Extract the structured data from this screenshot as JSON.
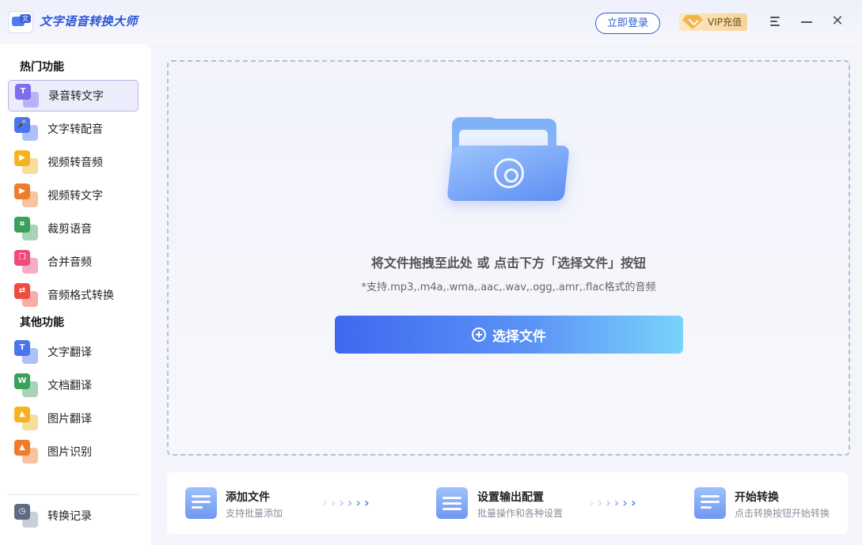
{
  "app": {
    "title": "文字语音转换大师",
    "logo_text": "文"
  },
  "header": {
    "login_label": "立即登录",
    "vip_label": "VIP充值"
  },
  "sidebar": {
    "hot_title": "热门功能",
    "hot_items": [
      {
        "label": "录音转文字",
        "icon": "record-to-text-icon",
        "glyph": "T",
        "color": "#7b6cf0",
        "active": true
      },
      {
        "label": "文字转配音",
        "icon": "text-to-voice-icon",
        "glyph": "🎤",
        "color": "#4a74f0",
        "active": false
      },
      {
        "label": "视频转音频",
        "icon": "video-to-audio-icon",
        "glyph": "▶",
        "color": "#f5b324",
        "active": false
      },
      {
        "label": "视频转文字",
        "icon": "video-to-text-icon",
        "glyph": "▶",
        "color": "#f07b2a",
        "active": false
      },
      {
        "label": "裁剪语音",
        "icon": "crop-audio-icon",
        "glyph": "⌗",
        "color": "#3aa05a",
        "active": false
      },
      {
        "label": "合并音频",
        "icon": "merge-audio-icon",
        "glyph": "❐",
        "color": "#ee4a7a",
        "active": false
      },
      {
        "label": "音频格式转换",
        "icon": "audio-format-icon",
        "glyph": "⇄",
        "color": "#ef4b3e",
        "active": false
      }
    ],
    "other_title": "其他功能",
    "other_items": [
      {
        "label": "文字翻译",
        "icon": "text-translate-icon",
        "glyph": "T",
        "color": "#4a74f0"
      },
      {
        "label": "文档翻译",
        "icon": "doc-translate-icon",
        "glyph": "W",
        "color": "#3aa05a"
      },
      {
        "label": "图片翻译",
        "icon": "image-translate-icon",
        "glyph": "▲",
        "color": "#f5b324"
      },
      {
        "label": "图片识别",
        "icon": "image-recognize-icon",
        "glyph": "▲",
        "color": "#f07b2a"
      }
    ],
    "history_label": "转换记录"
  },
  "main": {
    "drop_hint": "将文件拖拽至此处 或 点击下方「选择文件」按钮",
    "formats": "*支持.mp3,.m4a,.wma,.aac,.wav,.ogg,.amr,.flac格式的音频",
    "select_label": "选择文件"
  },
  "steps": [
    {
      "title": "添加文件",
      "sub": "支持批量添加"
    },
    {
      "title": "设置输出配置",
      "sub": "批量操作和各种设置"
    },
    {
      "title": "开始转换",
      "sub": "点击转换按钮开始转换"
    }
  ],
  "colors": {
    "accent": "#2f5cd6",
    "active_bg": "#ececfb"
  }
}
